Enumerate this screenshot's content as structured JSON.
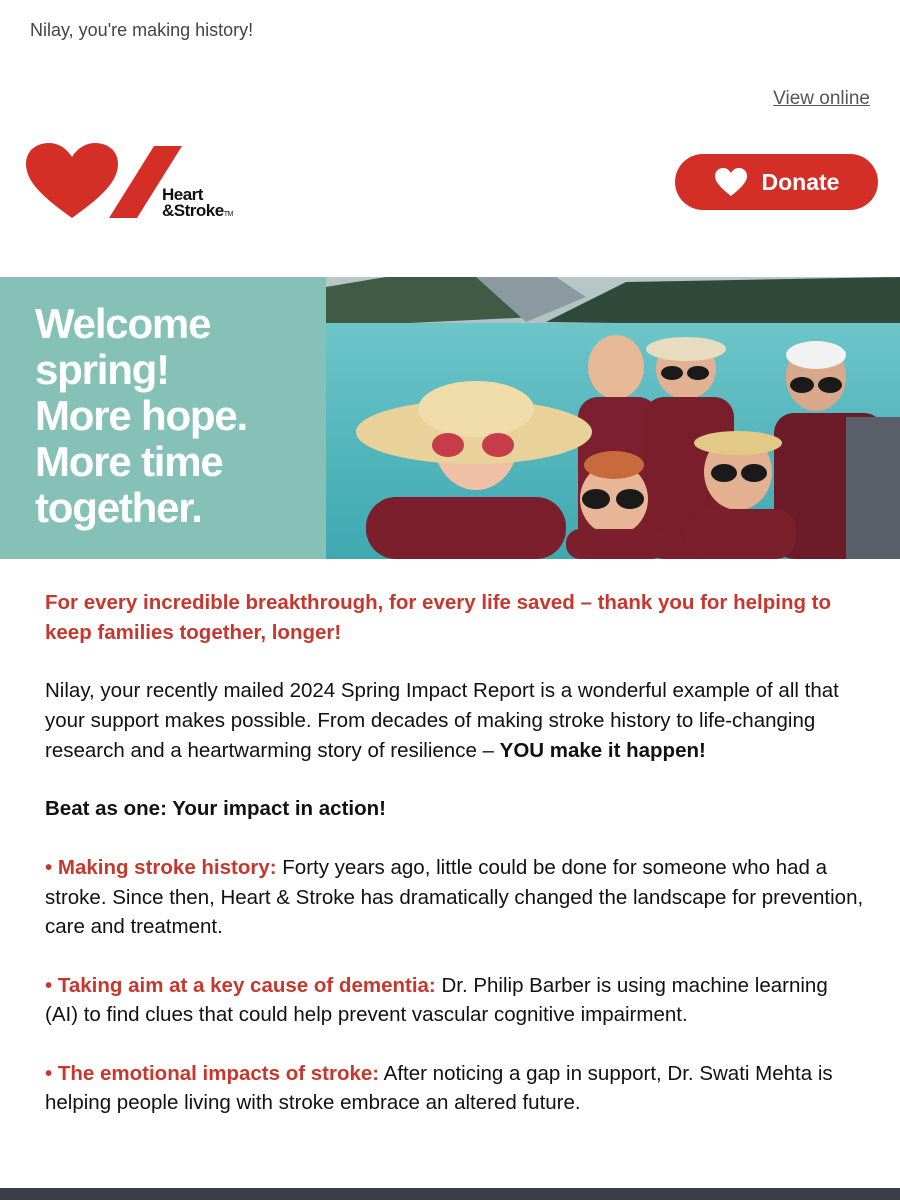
{
  "preheader": "Nilay, you're making history!",
  "view_online": "View online",
  "logo": {
    "line1": "Heart",
    "line2": "&Stroke",
    "tm": "TM"
  },
  "donate_label": "Donate",
  "hero": {
    "line1": "Welcome",
    "line2": "spring!",
    "line3": "More hope.",
    "line4": "More time",
    "line5": "together."
  },
  "content": {
    "lead": "For every incredible breakthrough, for every life saved – thank you for helping to keep families together, longer!",
    "para_main": "Nilay, your recently mailed 2024 Spring Impact Report is a wonderful example of all that your support makes possible. From decades of making stroke history to life-changing research and a heartwarming story of resilience – ",
    "para_bold": "YOU make it happen!",
    "section_title": "Beat as one: Your impact in action!",
    "bullets": [
      {
        "label": "• Making stroke history:",
        "text": " Forty years ago, little could be done for someone who had a stroke. Since then, Heart & Stroke has dramatically changed the landscape for prevention, care and treatment."
      },
      {
        "label": "• Taking aim at a key cause of dementia:",
        "text": " Dr. Philip Barber is using machine learning (AI) to find clues that could help prevent vascular cognitive impairment."
      },
      {
        "label": "• The emotional impacts of stroke:",
        "text": " After noticing a gap in support, Dr. Swati Mehta is helping people living with stroke embrace an altered future."
      }
    ]
  },
  "colors": {
    "brand_red": "#d32f26",
    "text_red": "#c8372d",
    "teal": "#86c1b8"
  }
}
